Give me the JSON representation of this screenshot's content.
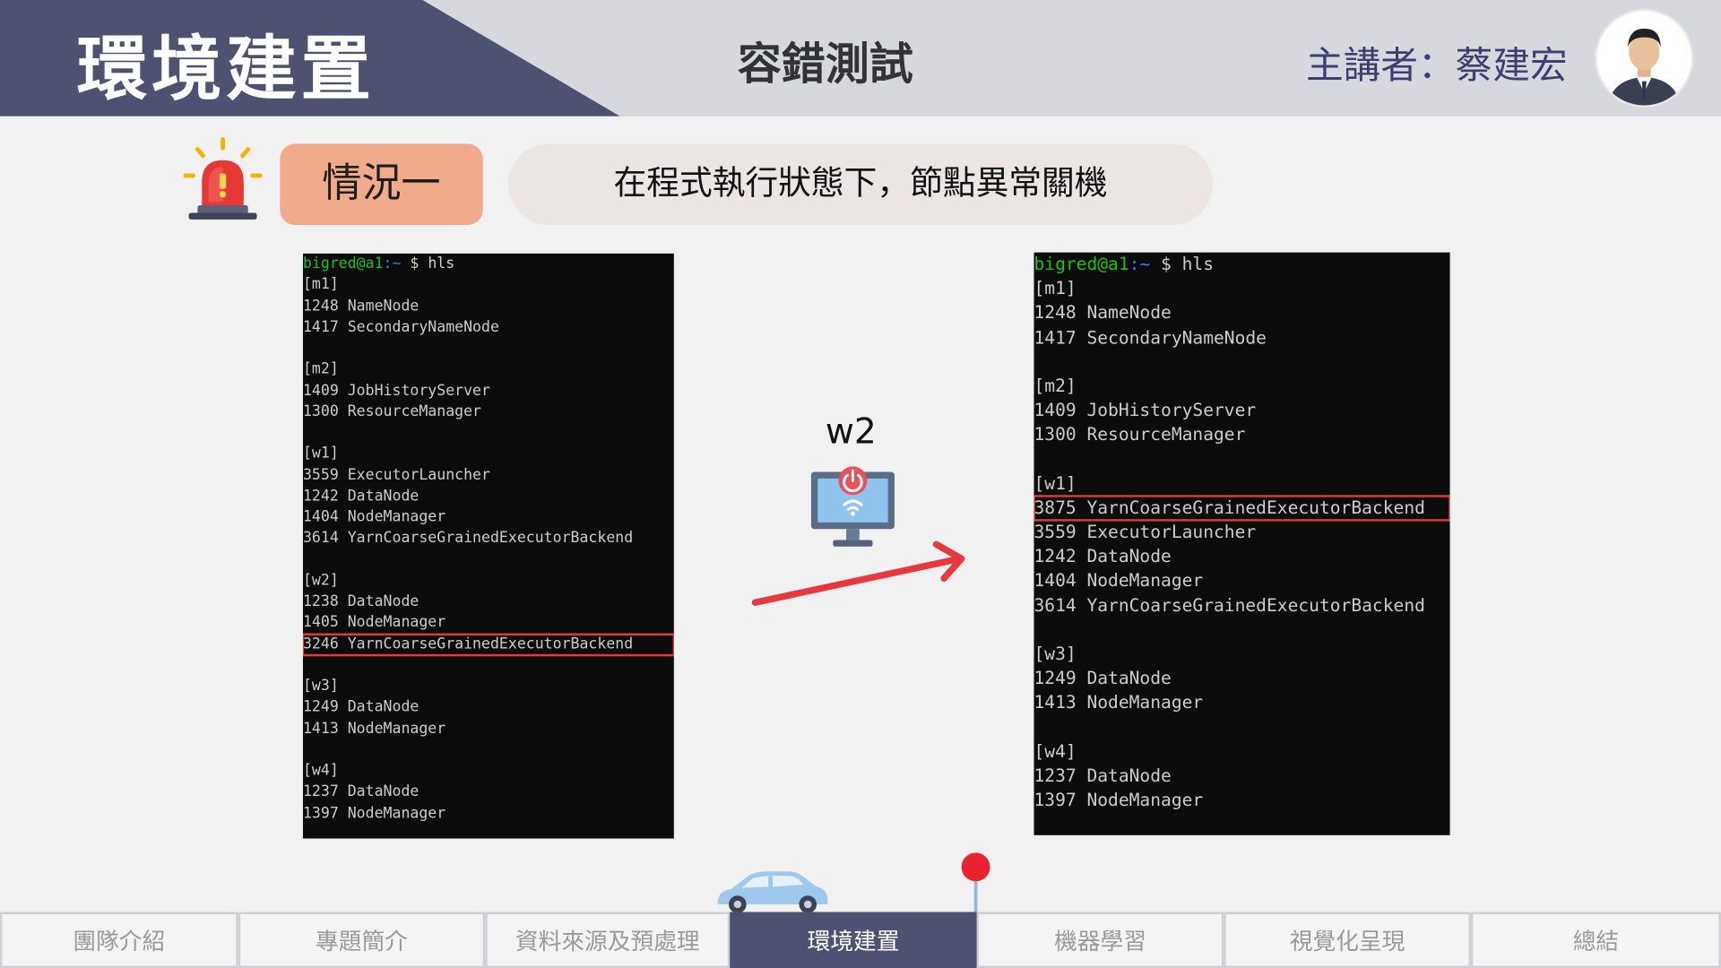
{
  "header": {
    "section_title": "環境建置",
    "slide_title": "容錯測試",
    "presenter": "主講者：蔡建宏"
  },
  "case": {
    "label": "情況一",
    "description": "在程式執行狀態下，節點異常關機"
  },
  "terminal_left": {
    "prompt_user": "bigred@a1",
    "prompt_path": ":~",
    "command": "$ hls",
    "lines": [
      "[m1]",
      "1248 NameNode",
      "1417 SecondaryNameNode",
      "",
      "[m2]",
      "1409 JobHistoryServer",
      "1300 ResourceManager",
      "",
      "[w1]",
      "3559 ExecutorLauncher",
      "1242 DataNode",
      "1404 NodeManager",
      "3614 YarnCoarseGrainedExecutorBackend",
      "",
      "[w2]",
      "1238 DataNode",
      "1405 NodeManager",
      "3246 YarnCoarseGrainedExecutorBackend",
      "",
      "[w3]",
      "1249 DataNode",
      "1413 NodeManager",
      "",
      "[w4]",
      "1237 DataNode",
      "1397 NodeManager"
    ],
    "highlighted_line": "3246 YarnCoarseGrainedExecutorBackend"
  },
  "terminal_right": {
    "prompt_user": "bigred@a1",
    "prompt_path": ":~",
    "command": "$ hls",
    "lines": [
      "[m1]",
      "1248 NameNode",
      "1417 SecondaryNameNode",
      "",
      "[m2]",
      "1409 JobHistoryServer",
      "1300 ResourceManager",
      "",
      "[w1]",
      "3875 YarnCoarseGrainedExecutorBackend",
      "3559 ExecutorLauncher",
      "1242 DataNode",
      "1404 NodeManager",
      "3614 YarnCoarseGrainedExecutorBackend",
      "",
      "[w3]",
      "1249 DataNode",
      "1413 NodeManager",
      "",
      "[w4]",
      "1237 DataNode",
      "1397 NodeManager"
    ],
    "highlighted_line": "3875 YarnCoarseGrainedExecutorBackend"
  },
  "node_label": "w2",
  "nav": {
    "items": [
      "團隊介紹",
      "專題簡介",
      "資料來源及預處理",
      "環境建置",
      "機器學習",
      "視覺化呈現",
      "總結"
    ],
    "active": "環境建置"
  },
  "colors": {
    "header_dark": "#4f5170",
    "header_light": "#d7d8dd",
    "case_label_bg": "#f2ab8a",
    "case_desc_bg": "#ebe6e3",
    "highlight": "#e23a3a",
    "arrow": "#e8383d"
  },
  "icons": [
    "alarm-siren-icon",
    "monitor-power-icon",
    "arrow-icon",
    "car-icon",
    "location-pin-icon",
    "presenter-avatar"
  ]
}
